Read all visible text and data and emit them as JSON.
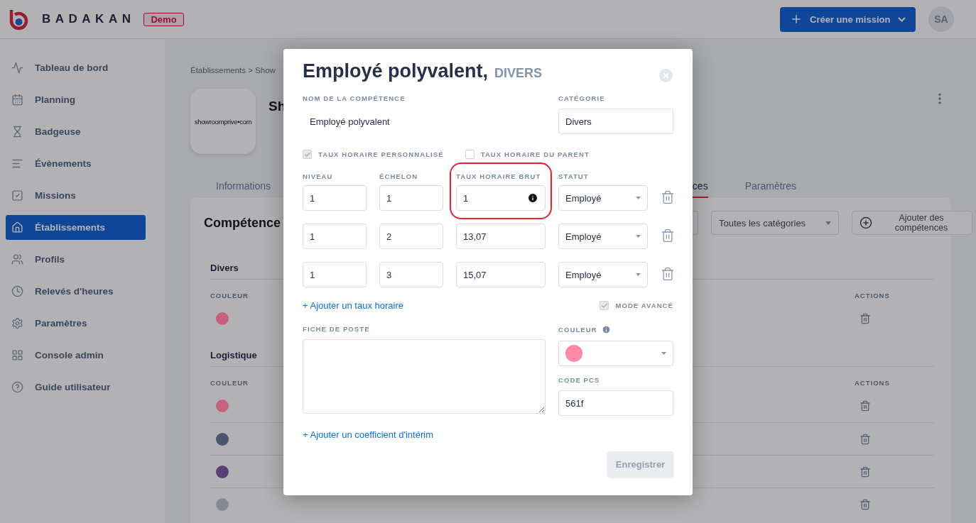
{
  "header": {
    "brand": "BADAKAN",
    "badge": "Demo",
    "create_button": "Créer une mission",
    "avatar": "SA"
  },
  "sidebar": {
    "items": [
      {
        "label": "Tableau de bord",
        "selected": false
      },
      {
        "label": "Planning",
        "selected": false
      },
      {
        "label": "Badgeuse",
        "selected": false
      },
      {
        "label": "Évènements",
        "selected": false
      },
      {
        "label": "Missions",
        "selected": false
      },
      {
        "label": "Établissements",
        "selected": true
      },
      {
        "label": "Profils",
        "selected": false
      },
      {
        "label": "Relevés d'heures",
        "selected": false
      },
      {
        "label": "Paramètres",
        "selected": false
      },
      {
        "label": "Console admin",
        "selected": false
      },
      {
        "label": "Guide utilisateur",
        "selected": false
      }
    ]
  },
  "page": {
    "breadcrumb": "Établissements > Show",
    "logo_text": "showroomprive•com",
    "title": "Sh",
    "tabs": [
      {
        "label": "Informations",
        "selected": false
      },
      {
        "label": "ces",
        "selected": true
      },
      {
        "label": "Paramètres",
        "selected": false
      }
    ],
    "card": {
      "title": "Compétence",
      "category_filter": "Toutes les catégories",
      "add_button": "Ajouter des compétences",
      "groups": [
        {
          "name": "Divers",
          "color_column": "COULEUR",
          "actions_column": "ACTIONS",
          "rows": [
            {
              "color": "#c5617f"
            }
          ]
        },
        {
          "name": "Logistique",
          "color_column": "COULEUR",
          "actions_column": "ACTIONS",
          "rows": [
            {
              "color": "#c5627f"
            },
            {
              "color": "#49566b"
            },
            {
              "color": "#5b4075"
            },
            {
              "color": "#838a92"
            }
          ]
        }
      ]
    }
  },
  "modal": {
    "title": "Employé polyvalent,",
    "subtitle": "DIVERS",
    "name_label": "NOM DE LA COMPÉTENCE",
    "name_value": "Employé polyvalent",
    "category_label": "CATÉGORIE",
    "category_value": "Divers",
    "options": [
      {
        "label": "TAUX HORAIRE PERSONNALISÉ",
        "checked": true,
        "disabled": true
      },
      {
        "label": "TAUX HORAIRE DU PARENT",
        "checked": false,
        "disabled": false
      }
    ],
    "rate_columns": [
      "NIVEAU",
      "ÉCHELON",
      "TAUX HORAIRE BRUT",
      "STATUT"
    ],
    "rates": [
      {
        "level": "1",
        "step": "1",
        "rate": "1",
        "status": "Employé",
        "highlighted": true
      },
      {
        "level": "1",
        "step": "2",
        "rate": "13,07",
        "status": "Employé",
        "highlighted": false
      },
      {
        "level": "1",
        "step": "3",
        "rate": "15,07",
        "status": "Employé",
        "highlighted": false
      }
    ],
    "add_rate_link": "+ Ajouter un taux horaire",
    "advanced_mode": {
      "label": "MODE AVANCÉ",
      "checked": true
    },
    "job_sheet_label": "FICHE DE POSTE",
    "color_label": "COULEUR",
    "pcs_label": "CODE PCS",
    "pcs_value": "561f",
    "add_coefficient_link": "+ Ajouter un coefficient d'intérim",
    "save_button": {
      "label": "Enregistrer",
      "disabled": true
    }
  }
}
